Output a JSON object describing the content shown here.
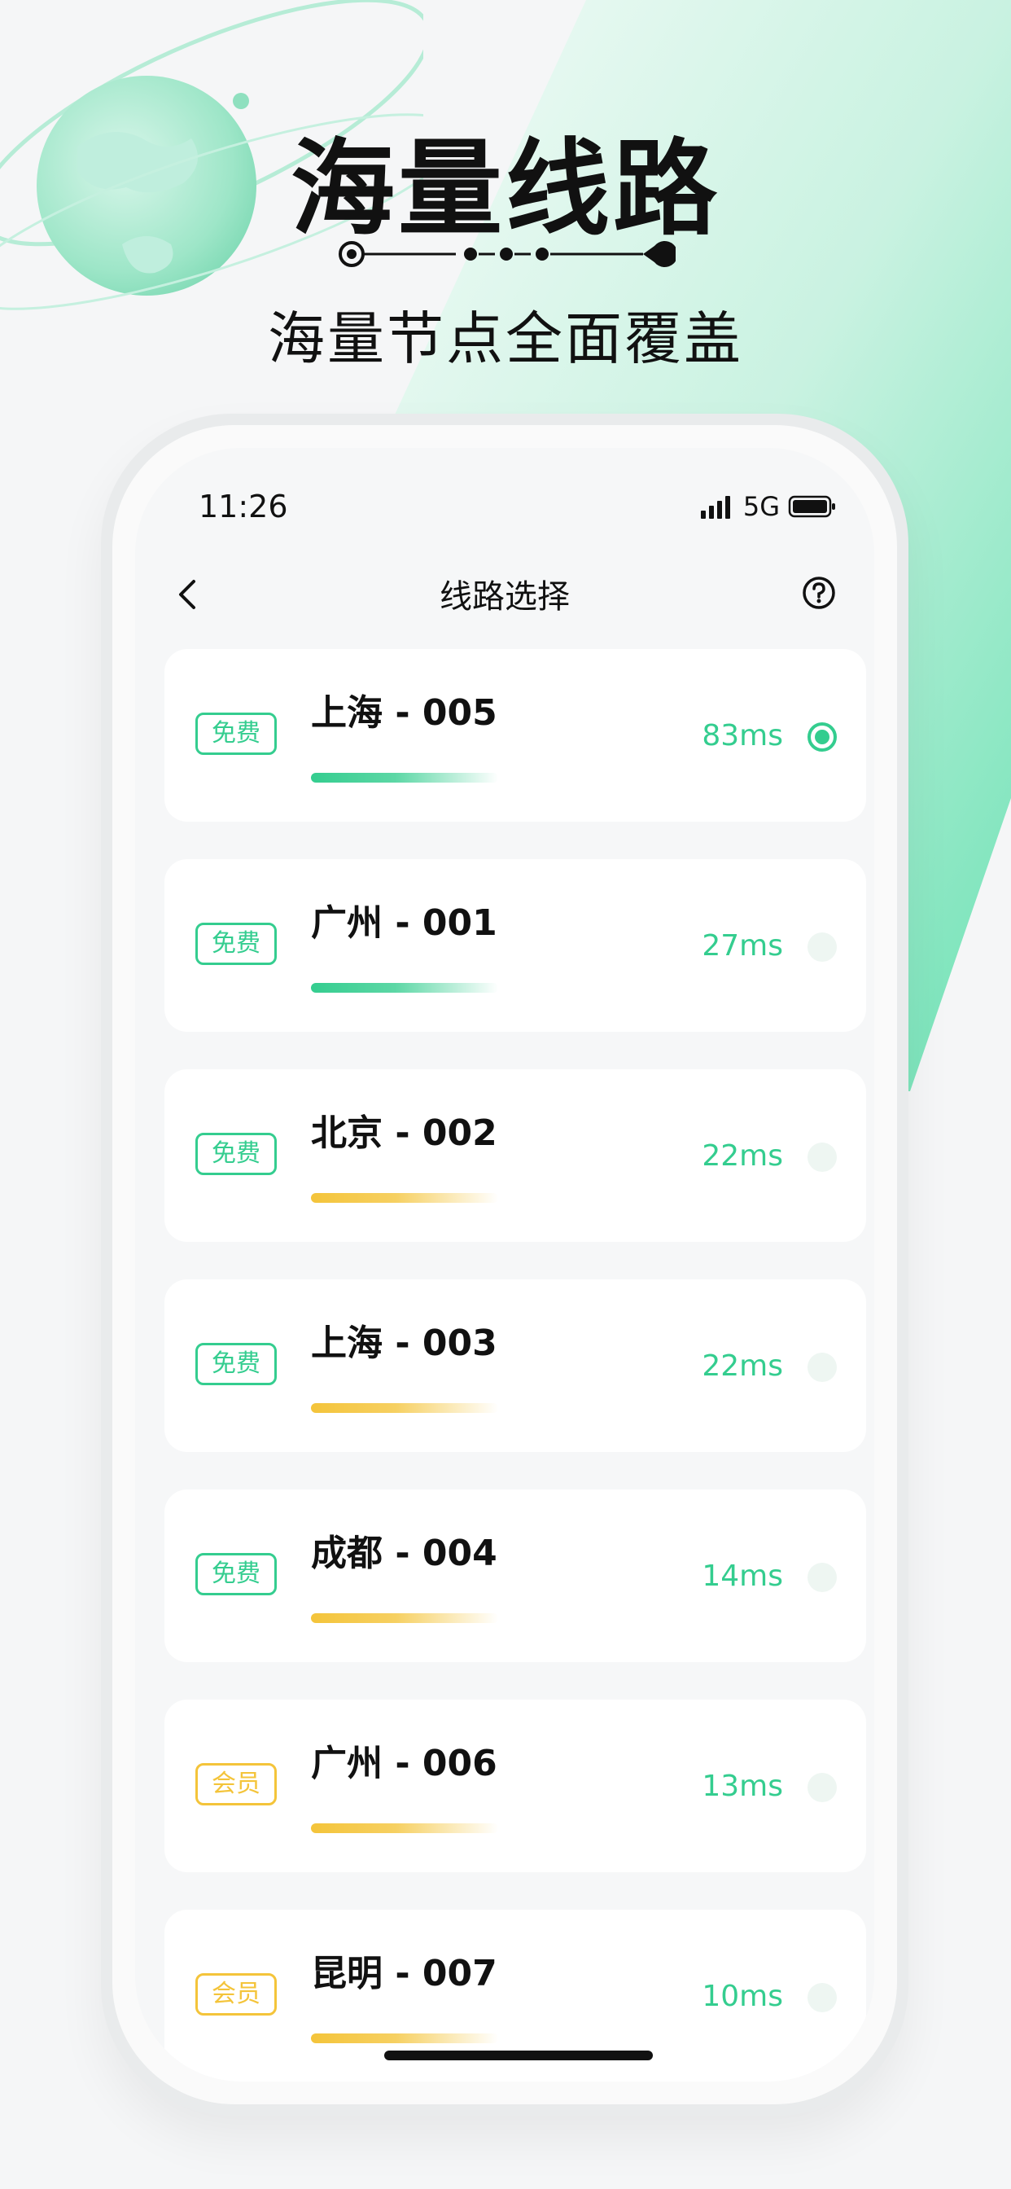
{
  "hero": {
    "title": "海量线路",
    "subtitle": "海量节点全面覆盖"
  },
  "status_bar": {
    "time": "11:26",
    "network": "5G"
  },
  "nav": {
    "title": "线路选择",
    "back_icon": "chevron-left-icon",
    "help_icon": "question-circle-icon"
  },
  "colors": {
    "accent_green": "#34cd8f",
    "accent_yellow": "#f4c43a"
  },
  "lines": [
    {
      "tag": "免费",
      "tier": "free",
      "name": "上海 - 005",
      "latency": "83ms",
      "selected": true
    },
    {
      "tag": "免费",
      "tier": "free",
      "name": "广州 - 001",
      "latency": "27ms",
      "selected": false
    },
    {
      "tag": "免费",
      "tier": "free",
      "name": "北京 - 002",
      "latency": "22ms",
      "selected": false
    },
    {
      "tag": "免费",
      "tier": "free",
      "name": "上海 - 003",
      "latency": "22ms",
      "selected": false
    },
    {
      "tag": "免费",
      "tier": "free",
      "name": "成都 - 004",
      "latency": "14ms",
      "selected": false
    },
    {
      "tag": "会员",
      "tier": "vip",
      "name": "广州 - 006",
      "latency": "13ms",
      "selected": false
    },
    {
      "tag": "会员",
      "tier": "vip",
      "name": "昆明 - 007",
      "latency": "10ms",
      "selected": false
    }
  ]
}
